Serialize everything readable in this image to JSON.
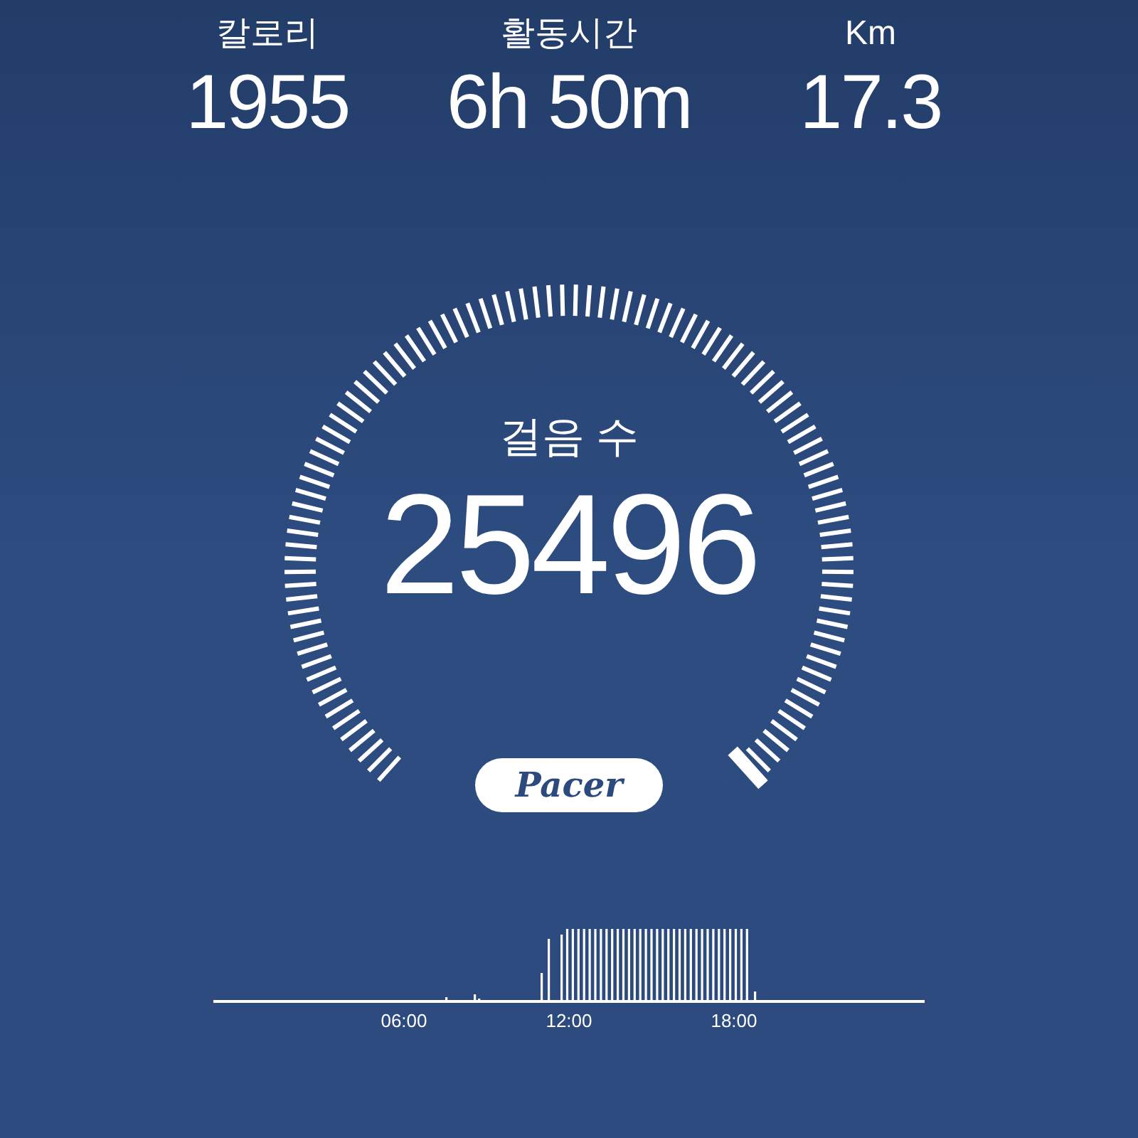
{
  "stats": [
    {
      "label": "칼로리",
      "value": "1955"
    },
    {
      "label": "활동시간",
      "value": "6h 50m"
    },
    {
      "label": "Km",
      "value": "17.3"
    }
  ],
  "gauge": {
    "label": "걸음 수",
    "value": "25496"
  },
  "logo": {
    "text": "Pacer"
  },
  "activity_chart": {
    "x_labels": [
      "06:00",
      "12:00",
      "18:00"
    ]
  }
}
